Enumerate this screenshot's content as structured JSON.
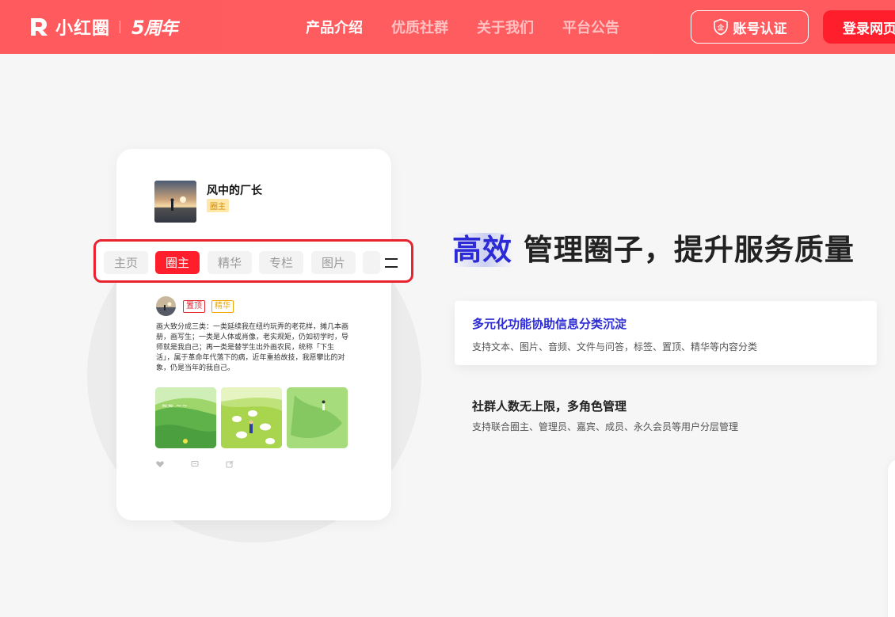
{
  "header": {
    "logo_text": "小红圈",
    "anniversary_num": "5",
    "anniversary_text": "周年",
    "nav": [
      {
        "label": "产品介绍",
        "active": true
      },
      {
        "label": "优质社群",
        "active": false
      },
      {
        "label": "关于我们",
        "active": false
      },
      {
        "label": "平台公告",
        "active": false
      }
    ],
    "cert_button": "账号认证",
    "login_button": "登录网页版"
  },
  "mock": {
    "profile_name": "风中的厂长",
    "profile_badge": "圈主",
    "tabs": [
      {
        "label": "主页",
        "active": false
      },
      {
        "label": "圈主",
        "active": true
      },
      {
        "label": "精华",
        "active": false
      },
      {
        "label": "专栏",
        "active": false
      },
      {
        "label": "图片",
        "active": false
      }
    ],
    "tag_top": "置顶",
    "tag_essence": "精华",
    "post_text": "画大致分成三类：一类延续我在纽约玩弄的老花样，摊几本画册，画写生；一类是人体或肖像，老实规矩，仍如初学时，导师就是我自己；再一类是替学生出外画农民，统称「下生活」，属于革命年代落下的病，近年重拾故技，我愿攀比的对象，仍是当年的我自己。"
  },
  "main": {
    "headline_highlight": "高效",
    "headline_rest": "管理圈子，提升服务质量",
    "features": [
      {
        "title": "多元化功能协助信息分类沉淀",
        "desc": "支持文本、图片、音频、文件与问答，标签、置顶、精华等内容分类"
      },
      {
        "title": "社群人数无上限，多角色管理",
        "desc": "支持联合圈主、管理员、嘉宾、成员、永久会员等用户分层管理"
      }
    ]
  },
  "colors": {
    "header_bg": "#ff5b5f",
    "accent_red": "#ff1f2c",
    "highlight_blue": "#2b2ad6"
  }
}
